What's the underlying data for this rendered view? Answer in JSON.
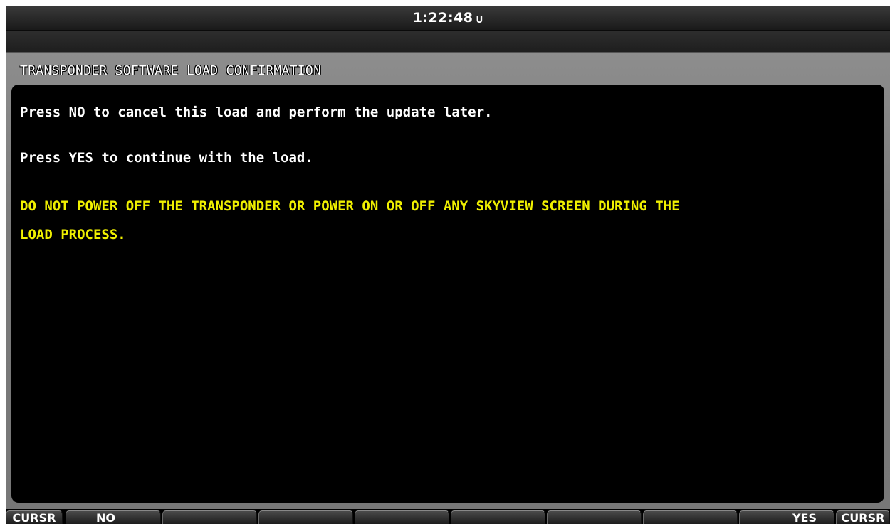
{
  "clock": {
    "time": "1:22:48",
    "unit": "U"
  },
  "panel": {
    "title": "TRANSPONDER SOFTWARE LOAD CONFIRMATION",
    "messages": [
      "Press NO to cancel this load and perform the update later.",
      "Press YES to continue with the load.",
      "DO NOT POWER OFF THE TRANSPONDER OR POWER ON OR OFF ANY SKYVIEW SCREEN DURING THE",
      "LOAD PROCESS."
    ]
  },
  "softkeys": {
    "left_knob": "CURSR",
    "b1": "NO",
    "b2": "",
    "b3": "",
    "b4": "",
    "b5": "",
    "b6": "",
    "b7": "",
    "b8": "YES",
    "right_knob": "CURSR"
  },
  "colors": {
    "warning_text": "#f0f000",
    "normal_text": "#ffffff",
    "background": "#000000"
  }
}
